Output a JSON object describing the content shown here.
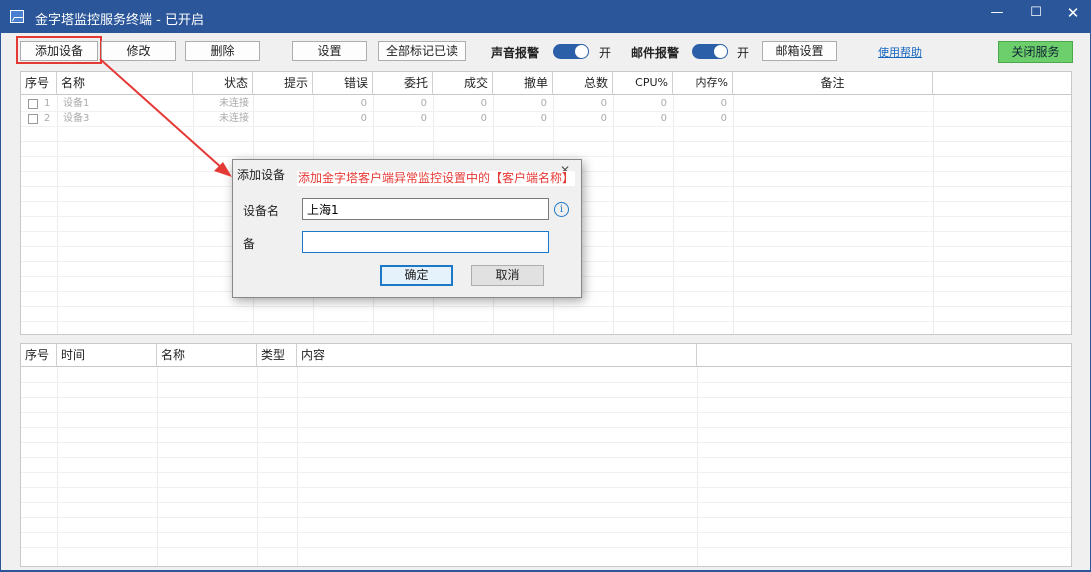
{
  "window": {
    "title": "金字塔监控服务终端 - 已开启",
    "controls": {
      "minimize": "—",
      "maximize": "☐",
      "close": "✕"
    }
  },
  "toolbar": {
    "add_device": "添加设备",
    "edit": "修改",
    "delete": "删除",
    "settings": "设置",
    "mark_all_read": "全部标记已读",
    "sound_alarm_label": "声音报警",
    "sound_alarm_state": "开",
    "mail_alarm_label": "邮件报警",
    "mail_alarm_state": "开",
    "mailbox_settings": "邮箱设置",
    "help_link": "使用帮助",
    "close_service": "关闭服务",
    "toggle_color": "#2b5fa8",
    "close_service_color": "#6ccf6c",
    "highlight_color": "#e53935"
  },
  "device_table": {
    "headers": [
      "序号",
      "名称",
      "状态",
      "提示",
      "错误",
      "委托",
      "成交",
      "撤单",
      "总数",
      "CPU%",
      "内存%",
      "备注"
    ],
    "rows": [
      {
        "no": "1",
        "name": "设备1",
        "status": "未连接",
        "error": "0",
        "order": "0",
        "deal": "0",
        "cancel": "0",
        "total": "0",
        "cpu": "0",
        "mem": "0"
      },
      {
        "no": "2",
        "name": "设备3",
        "status": "未连接",
        "error": "0",
        "order": "0",
        "deal": "0",
        "cancel": "0",
        "total": "0",
        "cpu": "0",
        "mem": "0"
      }
    ]
  },
  "log_table": {
    "headers": [
      "序号",
      "时间",
      "名称",
      "类型",
      "内容"
    ]
  },
  "dialog": {
    "title": "添加设备",
    "close": "✕",
    "annotation": "添加金字塔客户端异常监控设置中的【客户端名称】",
    "device_name_label": "设备名",
    "device_name_value": "上海1",
    "remark_label": "备",
    "remark_value": "",
    "info_icon": "i",
    "ok": "确定",
    "cancel": "取消"
  }
}
